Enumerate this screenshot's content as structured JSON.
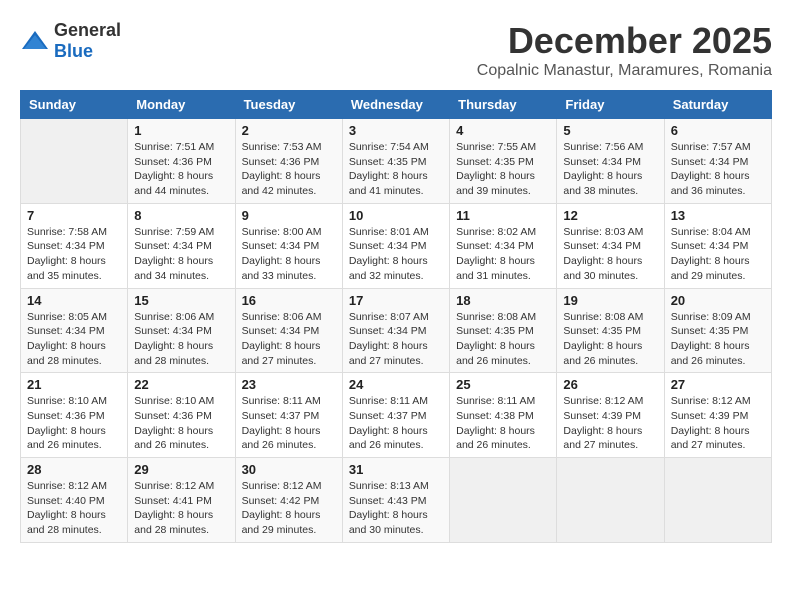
{
  "header": {
    "logo_general": "General",
    "logo_blue": "Blue",
    "month": "December 2025",
    "location": "Copalnic Manastur, Maramures, Romania"
  },
  "weekdays": [
    "Sunday",
    "Monday",
    "Tuesday",
    "Wednesday",
    "Thursday",
    "Friday",
    "Saturday"
  ],
  "weeks": [
    [
      {
        "day": "",
        "info": ""
      },
      {
        "day": "1",
        "info": "Sunrise: 7:51 AM\nSunset: 4:36 PM\nDaylight: 8 hours\nand 44 minutes."
      },
      {
        "day": "2",
        "info": "Sunrise: 7:53 AM\nSunset: 4:36 PM\nDaylight: 8 hours\nand 42 minutes."
      },
      {
        "day": "3",
        "info": "Sunrise: 7:54 AM\nSunset: 4:35 PM\nDaylight: 8 hours\nand 41 minutes."
      },
      {
        "day": "4",
        "info": "Sunrise: 7:55 AM\nSunset: 4:35 PM\nDaylight: 8 hours\nand 39 minutes."
      },
      {
        "day": "5",
        "info": "Sunrise: 7:56 AM\nSunset: 4:34 PM\nDaylight: 8 hours\nand 38 minutes."
      },
      {
        "day": "6",
        "info": "Sunrise: 7:57 AM\nSunset: 4:34 PM\nDaylight: 8 hours\nand 36 minutes."
      }
    ],
    [
      {
        "day": "7",
        "info": "Sunrise: 7:58 AM\nSunset: 4:34 PM\nDaylight: 8 hours\nand 35 minutes."
      },
      {
        "day": "8",
        "info": "Sunrise: 7:59 AM\nSunset: 4:34 PM\nDaylight: 8 hours\nand 34 minutes."
      },
      {
        "day": "9",
        "info": "Sunrise: 8:00 AM\nSunset: 4:34 PM\nDaylight: 8 hours\nand 33 minutes."
      },
      {
        "day": "10",
        "info": "Sunrise: 8:01 AM\nSunset: 4:34 PM\nDaylight: 8 hours\nand 32 minutes."
      },
      {
        "day": "11",
        "info": "Sunrise: 8:02 AM\nSunset: 4:34 PM\nDaylight: 8 hours\nand 31 minutes."
      },
      {
        "day": "12",
        "info": "Sunrise: 8:03 AM\nSunset: 4:34 PM\nDaylight: 8 hours\nand 30 minutes."
      },
      {
        "day": "13",
        "info": "Sunrise: 8:04 AM\nSunset: 4:34 PM\nDaylight: 8 hours\nand 29 minutes."
      }
    ],
    [
      {
        "day": "14",
        "info": "Sunrise: 8:05 AM\nSunset: 4:34 PM\nDaylight: 8 hours\nand 28 minutes."
      },
      {
        "day": "15",
        "info": "Sunrise: 8:06 AM\nSunset: 4:34 PM\nDaylight: 8 hours\nand 28 minutes."
      },
      {
        "day": "16",
        "info": "Sunrise: 8:06 AM\nSunset: 4:34 PM\nDaylight: 8 hours\nand 27 minutes."
      },
      {
        "day": "17",
        "info": "Sunrise: 8:07 AM\nSunset: 4:34 PM\nDaylight: 8 hours\nand 27 minutes."
      },
      {
        "day": "18",
        "info": "Sunrise: 8:08 AM\nSunset: 4:35 PM\nDaylight: 8 hours\nand 26 minutes."
      },
      {
        "day": "19",
        "info": "Sunrise: 8:08 AM\nSunset: 4:35 PM\nDaylight: 8 hours\nand 26 minutes."
      },
      {
        "day": "20",
        "info": "Sunrise: 8:09 AM\nSunset: 4:35 PM\nDaylight: 8 hours\nand 26 minutes."
      }
    ],
    [
      {
        "day": "21",
        "info": "Sunrise: 8:10 AM\nSunset: 4:36 PM\nDaylight: 8 hours\nand 26 minutes."
      },
      {
        "day": "22",
        "info": "Sunrise: 8:10 AM\nSunset: 4:36 PM\nDaylight: 8 hours\nand 26 minutes."
      },
      {
        "day": "23",
        "info": "Sunrise: 8:11 AM\nSunset: 4:37 PM\nDaylight: 8 hours\nand 26 minutes."
      },
      {
        "day": "24",
        "info": "Sunrise: 8:11 AM\nSunset: 4:37 PM\nDaylight: 8 hours\nand 26 minutes."
      },
      {
        "day": "25",
        "info": "Sunrise: 8:11 AM\nSunset: 4:38 PM\nDaylight: 8 hours\nand 26 minutes."
      },
      {
        "day": "26",
        "info": "Sunrise: 8:12 AM\nSunset: 4:39 PM\nDaylight: 8 hours\nand 27 minutes."
      },
      {
        "day": "27",
        "info": "Sunrise: 8:12 AM\nSunset: 4:39 PM\nDaylight: 8 hours\nand 27 minutes."
      }
    ],
    [
      {
        "day": "28",
        "info": "Sunrise: 8:12 AM\nSunset: 4:40 PM\nDaylight: 8 hours\nand 28 minutes."
      },
      {
        "day": "29",
        "info": "Sunrise: 8:12 AM\nSunset: 4:41 PM\nDaylight: 8 hours\nand 28 minutes."
      },
      {
        "day": "30",
        "info": "Sunrise: 8:12 AM\nSunset: 4:42 PM\nDaylight: 8 hours\nand 29 minutes."
      },
      {
        "day": "31",
        "info": "Sunrise: 8:13 AM\nSunset: 4:43 PM\nDaylight: 8 hours\nand 30 minutes."
      },
      {
        "day": "",
        "info": ""
      },
      {
        "day": "",
        "info": ""
      },
      {
        "day": "",
        "info": ""
      }
    ]
  ]
}
